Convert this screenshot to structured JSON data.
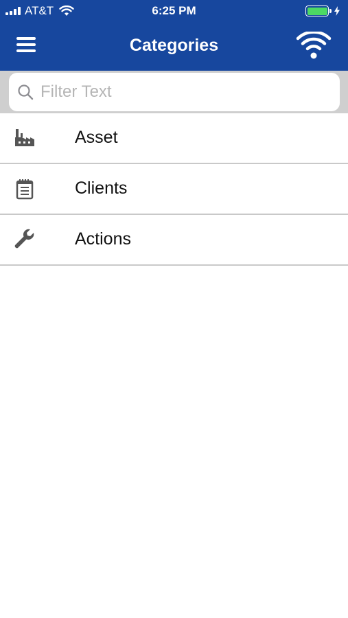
{
  "status_bar": {
    "carrier": "AT&T",
    "time": "6:25 PM",
    "battery_color": "#4cd964"
  },
  "nav": {
    "title": "Categories",
    "menu_icon": "hamburger-menu-icon",
    "right_icon": "wifi-icon",
    "bar_color": "#17479e"
  },
  "search": {
    "placeholder": "Filter Text",
    "value": ""
  },
  "categories": [
    {
      "label": "Asset",
      "icon": "factory-icon"
    },
    {
      "label": "Clients",
      "icon": "notepad-icon"
    },
    {
      "label": "Actions",
      "icon": "wrench-icon"
    }
  ]
}
